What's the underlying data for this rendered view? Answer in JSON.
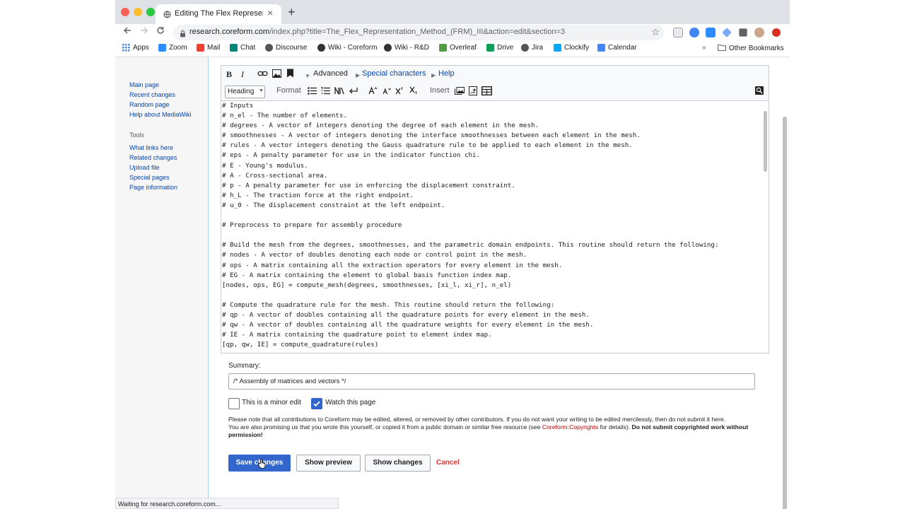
{
  "browser": {
    "tab_title": "Editing The Flex Representatio",
    "close_glyph": "×",
    "newtab_glyph": "+",
    "url_main": "research.coreform.com",
    "url_rest": "/index.php?title=The_Flex_Representation_Method_(FRM)_III&action=edit&section=3",
    "bookmarks": [
      {
        "label": "Apps",
        "color": "#4285f4"
      },
      {
        "label": "Zoom",
        "color": "#2d8cff"
      },
      {
        "label": "Mail",
        "color": "#ea4335"
      },
      {
        "label": "Chat",
        "color": "#00897b"
      },
      {
        "label": "Discourse",
        "color": "#555555"
      },
      {
        "label": "Wiki - Coreform",
        "color": "#333333"
      },
      {
        "label": "Wiki - R&D",
        "color": "#333333"
      },
      {
        "label": "Overleaf",
        "color": "#4f9c45"
      },
      {
        "label": "Drive",
        "color": "#0f9d58"
      },
      {
        "label": "Jira",
        "color": "#555555"
      },
      {
        "label": "Clockify",
        "color": "#03a9f4"
      },
      {
        "label": "Calendar",
        "color": "#4285f4"
      }
    ],
    "more_glyph": "»",
    "other_bookmarks": "Other Bookmarks",
    "status": "Waiting for research.coreform.com..."
  },
  "sidebar": {
    "nav": [
      "Main page",
      "Recent changes",
      "Random page",
      "Help about MediaWiki"
    ],
    "tools_heading": "Tools",
    "tools": [
      "What links here",
      "Related changes",
      "Upload file",
      "Special pages",
      "Page information"
    ]
  },
  "editor": {
    "bold": "B",
    "italic": "I",
    "advanced": "Advanced",
    "special_chars": "Special characters",
    "help": "Help",
    "heading_select": "Heading",
    "format": "Format",
    "insert": "Insert",
    "code_lines": [
      "# Inputs",
      "# n_el - The number of elements.",
      "# degrees - A vector of integers denoting the degree of each element in the mesh.",
      "# smoothnesses - A vector of integers denoting the interface smoothnesses between each element in the mesh.",
      "# rules - A vector integers denoting the Gauss quadrature rule to be applied to each element in the mesh.",
      "# eps - A penalty parameter for use in the indicator function chi.",
      "# E - Young's modulus.",
      "# A - Cross-sectional area.",
      "# p - A penalty parameter for use in enforcing the displacement constraint.",
      "# h_L - The traction force at the right endpoint.",
      "# u_0 - The displacement constraint at the left endpoint.",
      "",
      "# Preprocess to prepare for assembly procedure",
      "",
      "# Build the mesh from the degrees, smoothnesses, and the parametric domain endpoints. This routine should return the following:",
      "# nodes - A vector of doubles denoting each node or control point in the mesh.",
      "# ops - A matrix containing all the extraction operators for every element in the mesh.",
      "# EG - A matrix containing the element to global basis function index map.",
      "[nodes, ops, EG] = compute_mesh(degrees, smoothnesses, [xi_l, xi_r], n_el)",
      "",
      "# Compute the quadrature rule for the mesh. This routine should return the following:",
      "# qp - A vector of doubles containing all the quadrature points for every element in the mesh.",
      "# qw - A vector of doubles containing all the quadrature weights for every element in the mesh.",
      "# IE - A matrix containing the quadrature point to element index map.",
      "[qp, qw, IE] = compute_quadrature(rules)"
    ]
  },
  "form": {
    "summary_label": "Summary:",
    "summary_value": "/* Assembly of matrices and vectors */",
    "minor_edit": "This is a minor edit",
    "watch_page": "Watch this page",
    "notice_1": "Please note that all contributions to Coreform may be edited, altered, or removed by other contributors. If you do not want your writing to be edited mercilessly, then do not submit it here.",
    "notice_2a": "You are also promising us that you wrote this yourself, or copied it from a public domain or similar free resource (see ",
    "notice_link": "Coreform:Copyrights",
    "notice_2b": " for details). ",
    "notice_bold": "Do not submit copyrighted work without permission!",
    "save": "Save changes",
    "preview": "Show preview",
    "changes": "Show changes",
    "cancel": "Cancel"
  },
  "colors": {
    "link": "#0645ad",
    "primary_button": "#3366cc",
    "cancel": "#dd3333"
  }
}
